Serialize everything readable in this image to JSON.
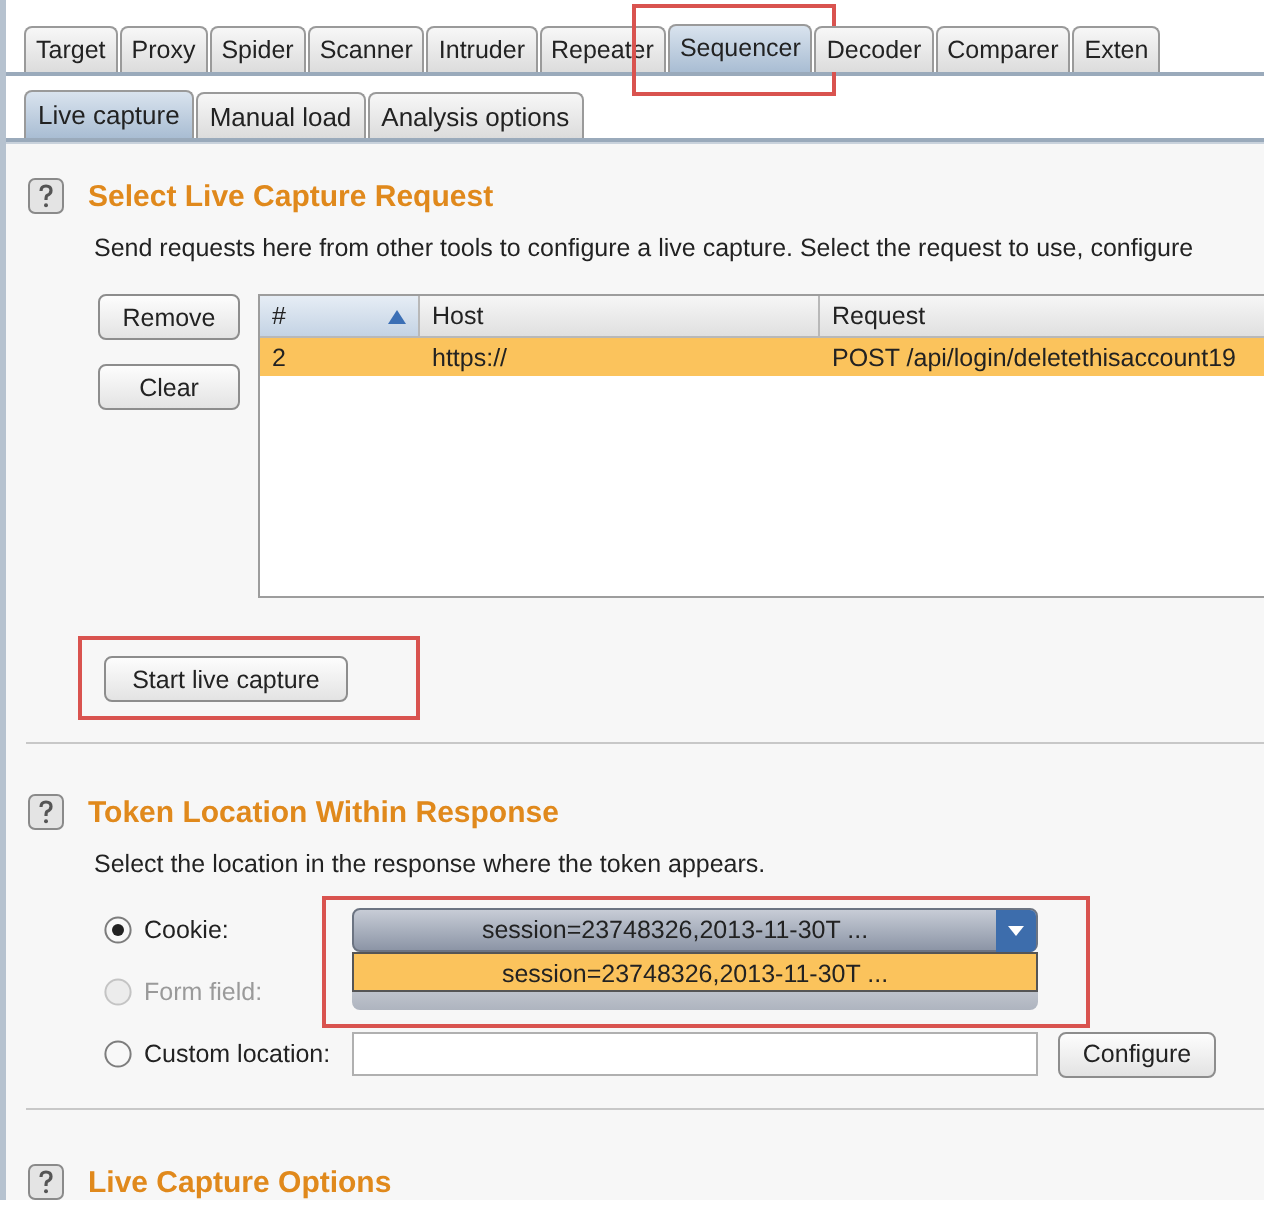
{
  "tabs": [
    {
      "label": "Target",
      "selected": false,
      "highlighted": false
    },
    {
      "label": "Proxy",
      "selected": false,
      "highlighted": false
    },
    {
      "label": "Spider",
      "selected": false,
      "highlighted": false
    },
    {
      "label": "Scanner",
      "selected": false,
      "highlighted": false
    },
    {
      "label": "Intruder",
      "selected": false,
      "highlighted": false
    },
    {
      "label": "Repeater",
      "selected": false,
      "highlighted": false
    },
    {
      "label": "Sequencer",
      "selected": true,
      "highlighted": true
    },
    {
      "label": "Decoder",
      "selected": false,
      "highlighted": false
    },
    {
      "label": "Comparer",
      "selected": false,
      "highlighted": false
    },
    {
      "label": "Exten",
      "selected": false,
      "highlighted": false
    }
  ],
  "subtabs": [
    {
      "label": "Live capture",
      "selected": true
    },
    {
      "label": "Manual load",
      "selected": false
    },
    {
      "label": "Analysis options",
      "selected": false
    }
  ],
  "request_section": {
    "title": "Select Live Capture Request",
    "description": "Send requests here from other tools to configure a live capture. Select the request to use, configure",
    "buttons": [
      "Remove",
      "Clear"
    ],
    "table": {
      "columns": [
        {
          "label": "#",
          "sorted": true
        },
        {
          "label": "Host",
          "sorted": false
        },
        {
          "label": "Request",
          "sorted": false
        }
      ],
      "rows": [
        {
          "cells": [
            "2",
            "https://",
            "POST /api/login/deletethisaccount19"
          ],
          "selected": true
        }
      ]
    },
    "start_button": {
      "label": "Start live capture",
      "highlighted": true
    }
  },
  "token_section": {
    "title": "Token Location Within Response",
    "description": "Select the location in the response where the token appears.",
    "options": [
      {
        "kind": "dropdown",
        "label": "Cookie:",
        "selected": true,
        "disabled": false,
        "value": "session=23748326,2013-11-30T ...",
        "highlighted": true,
        "popup_items": [
          {
            "label": "session=23748326,2013-11-30T ...",
            "selected": true
          }
        ]
      },
      {
        "kind": "plain",
        "label": "Form field:",
        "selected": false,
        "disabled": true
      },
      {
        "kind": "text",
        "label": "Custom location:",
        "selected": false,
        "disabled": false,
        "button": "Configure"
      }
    ]
  },
  "options_section": {
    "title": "Live Capture Options"
  }
}
